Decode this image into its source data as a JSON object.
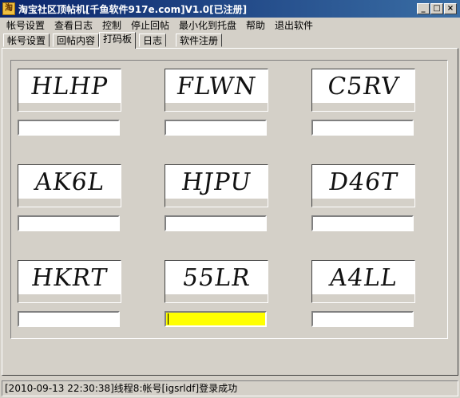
{
  "window": {
    "title": "淘宝社区顶帖机[千鱼软件917e.com]V1.0[已注册]",
    "minimize": "_",
    "maximize": "□",
    "close": "×"
  },
  "menu": [
    "帐号设置",
    "查看日志",
    "控制",
    "停止回帖",
    "最小化到托盘",
    "帮助",
    "退出软件"
  ],
  "tabs": [
    "帐号设置",
    "回帖内容",
    "打码板",
    "日志",
    "软件注册"
  ],
  "active_tab": "打码板",
  "captchas": [
    {
      "code": "HLHP",
      "input": ""
    },
    {
      "code": "FLWN",
      "input": ""
    },
    {
      "code": "C5RV",
      "input": ""
    },
    {
      "code": "AK6L",
      "input": ""
    },
    {
      "code": "HJPU",
      "input": ""
    },
    {
      "code": "D46T",
      "input": ""
    },
    {
      "code": "HKRT",
      "input": ""
    },
    {
      "code": "55LR",
      "input": ""
    },
    {
      "code": "A4LL",
      "input": ""
    }
  ],
  "focused_captcha": 8,
  "status": "[2010-09-13 22:30:38]线程8:帐号[igsrldf]登录成功",
  "colors": {
    "focus_bg": "#ffff00",
    "title_bar": "#0a246a"
  }
}
